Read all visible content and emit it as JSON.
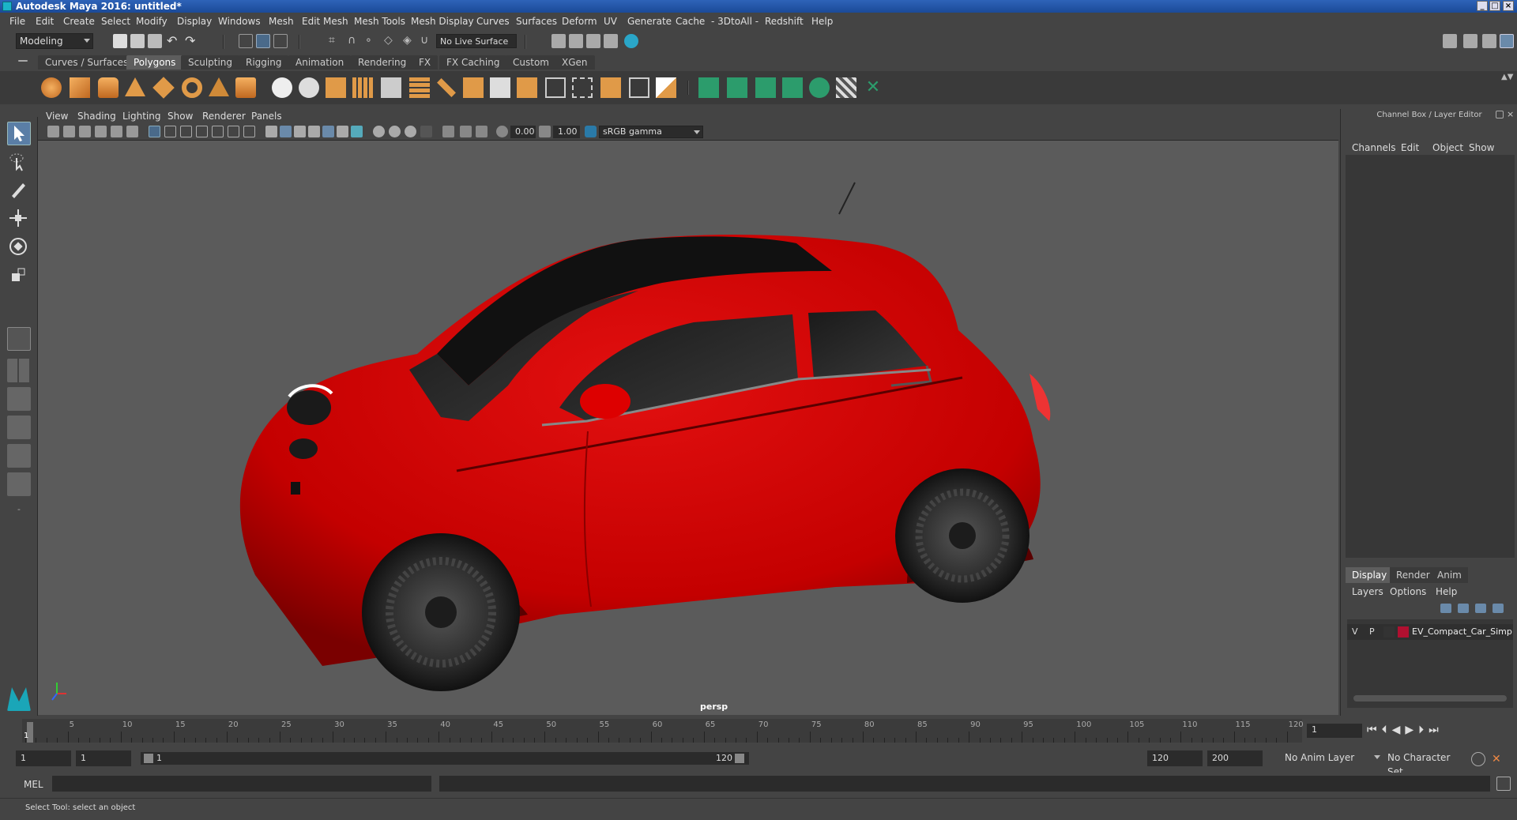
{
  "window": {
    "title": "Autodesk Maya 2016: untitled*"
  },
  "menu": [
    "File",
    "Edit",
    "Create",
    "Select",
    "Modify",
    "Display",
    "Windows",
    "Mesh",
    "Edit Mesh",
    "Mesh Tools",
    "Mesh Display",
    "Curves",
    "Surfaces",
    "Deform",
    "UV",
    "Generate",
    "Cache",
    "- 3DtoAll -",
    "Redshift",
    "Help"
  ],
  "status": {
    "menuset": "Modeling",
    "live_surface": "No Live Surface"
  },
  "shelf": {
    "tabs": [
      "Curves / Surfaces",
      "Polygons",
      "Sculpting",
      "Rigging",
      "Animation",
      "Rendering",
      "FX",
      "FX Caching",
      "Custom",
      "XGen"
    ],
    "active": "Polygons"
  },
  "viewport": {
    "menu": [
      "View",
      "Shading",
      "Lighting",
      "Show",
      "Renderer",
      "Panels"
    ],
    "exposure": "0.00",
    "gamma": "1.00",
    "colorspace": "sRGB gamma",
    "camera": "persp"
  },
  "channelbox": {
    "title": "Channel Box / Layer Editor",
    "menu": [
      "Channels",
      "Edit",
      "Object",
      "Show"
    ]
  },
  "layers": {
    "tabs": [
      "Display",
      "Render",
      "Anim"
    ],
    "active": "Display",
    "menu": [
      "Layers",
      "Options",
      "Help"
    ],
    "row": {
      "v": "V",
      "p": "P",
      "name": "EV_Compact_Car_Simp",
      "color": "#b01030"
    }
  },
  "timeline": {
    "ticks": [
      "5",
      "10",
      "15",
      "20",
      "25",
      "30",
      "35",
      "40",
      "45",
      "50",
      "55",
      "60",
      "65",
      "70",
      "75",
      "80",
      "85",
      "90",
      "95",
      "100",
      "105",
      "110",
      "115",
      "120"
    ],
    "start_label": "1",
    "current": "1"
  },
  "range": {
    "start": "1",
    "playback_start": "1",
    "slider_start": "1",
    "slider_end": "120",
    "playback_end": "120",
    "end": "200",
    "anim_layer": "No Anim Layer",
    "char_set": "No Character Set"
  },
  "cmd": {
    "label": "MEL"
  },
  "help": {
    "text": "Select Tool: select an object"
  }
}
